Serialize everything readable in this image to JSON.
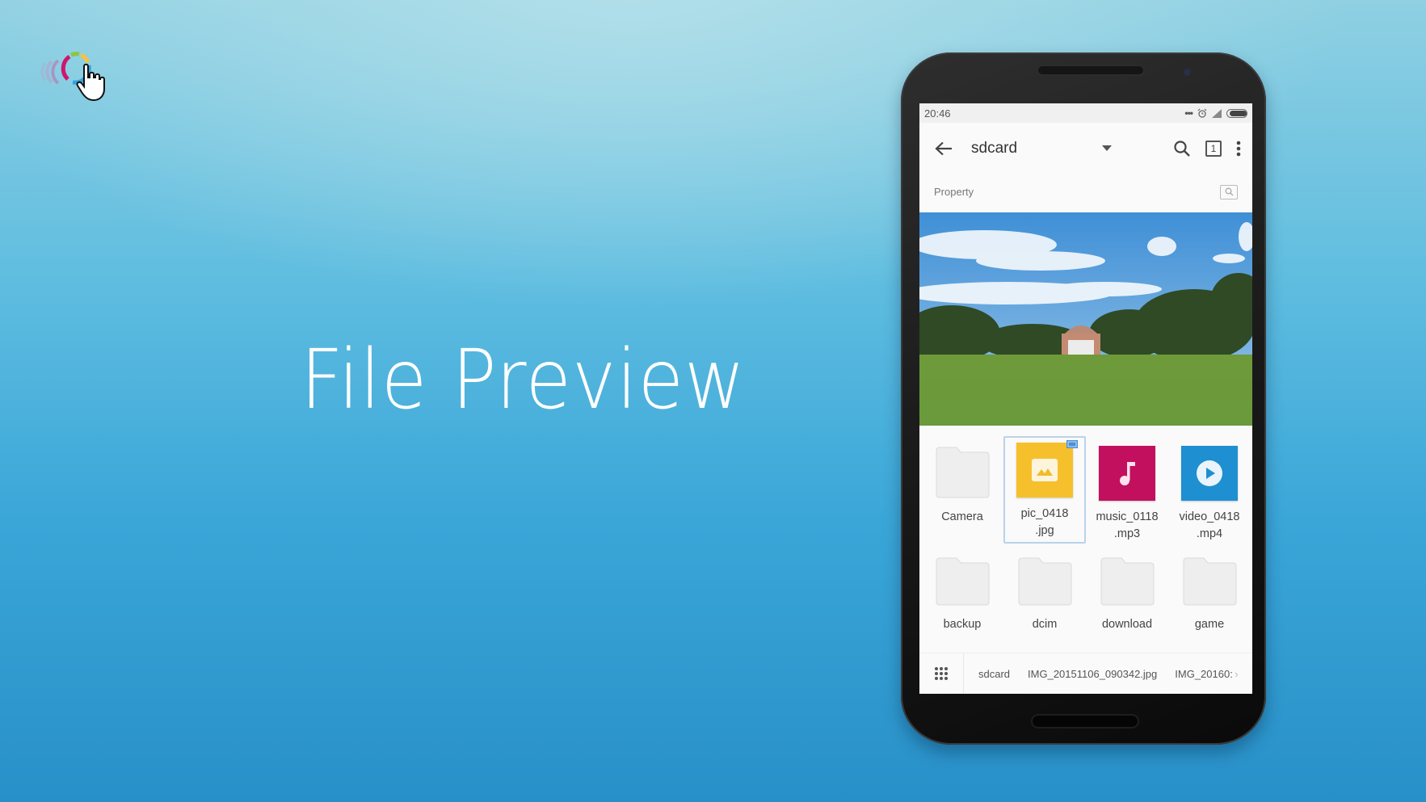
{
  "hero": {
    "title": "File Preview"
  },
  "logo": {
    "name": "logo-icon",
    "colors": [
      "#d0156e",
      "#8cc63f",
      "#f5c242",
      "#2ea3dc"
    ]
  },
  "phone": {
    "statusbar": {
      "time": "20:46",
      "icons": [
        "more-dots-icon",
        "alarm-icon",
        "signal-icon",
        "battery-icon"
      ]
    },
    "toolbar": {
      "title": "sdcard",
      "tab_count": "1"
    },
    "property": {
      "label": "Property"
    },
    "files_row1": [
      {
        "name": "Camera",
        "line2": "",
        "type": "folder"
      },
      {
        "name": "pic_0418",
        "line2": ".jpg",
        "type": "image",
        "color": "#f6c02d",
        "selected": true
      },
      {
        "name": "music_0118",
        "line2": ".mp3",
        "type": "audio",
        "color": "#c2105e"
      },
      {
        "name": "video_0418",
        "line2": ".mp4",
        "type": "video",
        "color": "#1e8fd0"
      }
    ],
    "files_row2": [
      {
        "name": "backup",
        "type": "folder"
      },
      {
        "name": "dcim",
        "type": "folder"
      },
      {
        "name": "download",
        "type": "folder"
      },
      {
        "name": "game",
        "type": "folder"
      }
    ],
    "breadcrumbs": [
      "sdcard",
      "IMG_20151106_090342.jpg",
      "IMG_20160:"
    ]
  }
}
